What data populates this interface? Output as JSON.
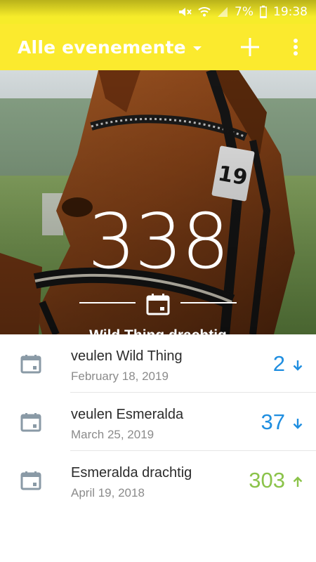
{
  "status_bar": {
    "battery": "7%",
    "time": "19:38",
    "icons": [
      "mute-icon",
      "wifi-icon",
      "signal-icon",
      "battery-icon"
    ]
  },
  "app_bar": {
    "title": "Alle evenemente",
    "icons": [
      "dropdown-caret-icon",
      "add-icon",
      "overflow-menu-icon"
    ],
    "color": "#fbea2e"
  },
  "hero": {
    "count": "338",
    "name": "Wild Thing drachtig",
    "icon": "calendar-icon"
  },
  "events": [
    {
      "title": "veulen Wild Thing",
      "date": "February 18, 2019",
      "count": "2",
      "direction": "down",
      "color": "#1f8ee0"
    },
    {
      "title": "veulen Esmeralda",
      "date": "March 25, 2019",
      "count": "37",
      "direction": "down",
      "color": "#1f8ee0"
    },
    {
      "title": "Esmeralda drachtig",
      "date": "April 19, 2018",
      "count": "303",
      "direction": "up",
      "color": "#8bc34a"
    }
  ]
}
